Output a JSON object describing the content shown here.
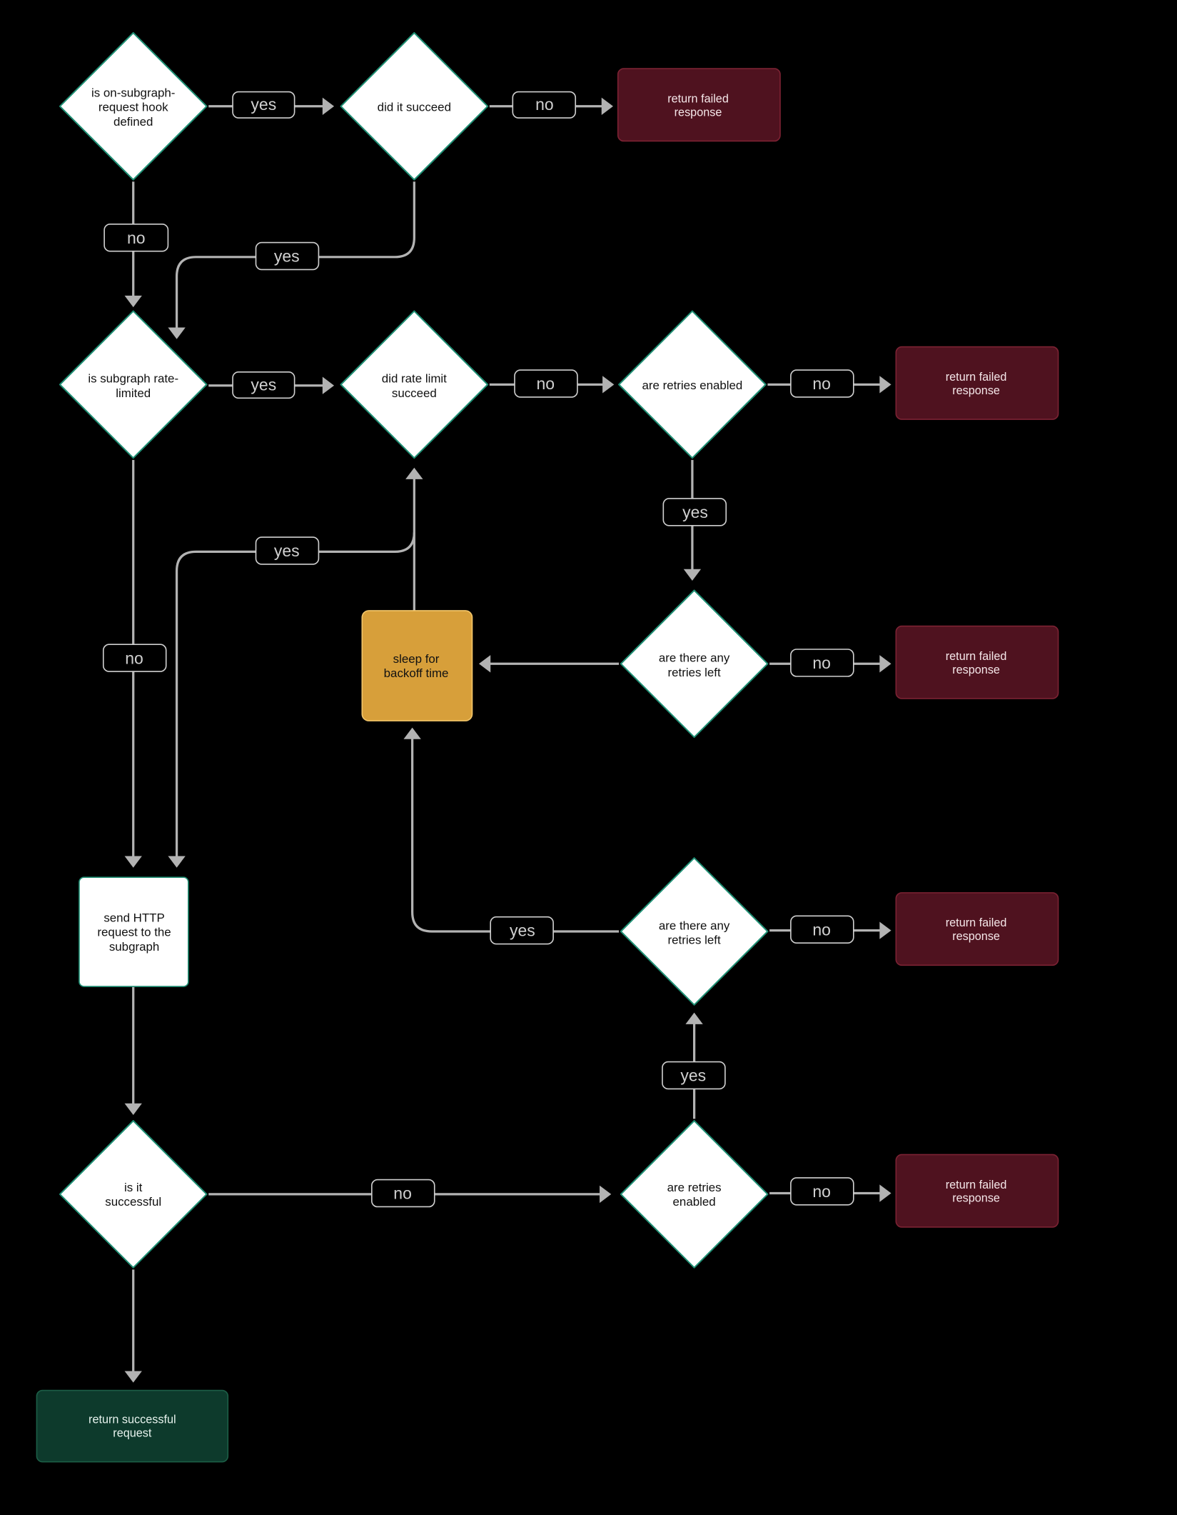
{
  "colors": {
    "background": "#000000",
    "decision_fill": "#ffffff",
    "decision_stroke": "#1f8f74",
    "failure_fill": "#4f121f",
    "sleep_fill": "#d79f3a",
    "success_fill": "#0d3a2c",
    "edge": "#b3b3b3"
  },
  "nodes": {
    "hook_defined": [
      "is on-subgraph-",
      "request hook",
      "defined"
    ],
    "hook_succeeded": [
      "did it succeed"
    ],
    "fail_hook": [
      "return failed",
      "response"
    ],
    "rate_limited": [
      "is subgraph rate-",
      "limited"
    ],
    "rate_limit_succeeded": [
      "did rate limit",
      "succeed"
    ],
    "retries_enabled_1": [
      "are retries enabled"
    ],
    "fail_retries_disabled_1": [
      "return failed",
      "response"
    ],
    "retries_left_1": [
      "are there any",
      "retries left"
    ],
    "fail_no_retries_1": [
      "return failed",
      "response"
    ],
    "sleep": [
      "sleep for",
      "backoff time"
    ],
    "retries_left_2": [
      "are there any",
      "retries left"
    ],
    "fail_no_retries_2": [
      "return failed",
      "response"
    ],
    "send_request": [
      "send HTTP",
      "request to the",
      "subgraph"
    ],
    "is_successful": [
      "is it",
      "successful"
    ],
    "retries_enabled_2": [
      "are retries",
      "enabled"
    ],
    "fail_retries_disabled_2": [
      "return failed",
      "response"
    ],
    "success": [
      "return successful",
      "request"
    ]
  },
  "edge_labels": {
    "hook_yes": "yes",
    "hook_fail_no": "no",
    "hook_no": "no",
    "hook_ok_yes": "yes",
    "rate_yes": "yes",
    "rate_fail_no": "no",
    "retries1_no": "no",
    "retries1_yes": "yes",
    "rate_ok_yes": "yes",
    "rate_no": "no",
    "left1_no": "no",
    "left2_yes": "yes",
    "left2_no": "no",
    "retries2_yes": "yes",
    "success_no": "no",
    "retries2_no": "no"
  }
}
